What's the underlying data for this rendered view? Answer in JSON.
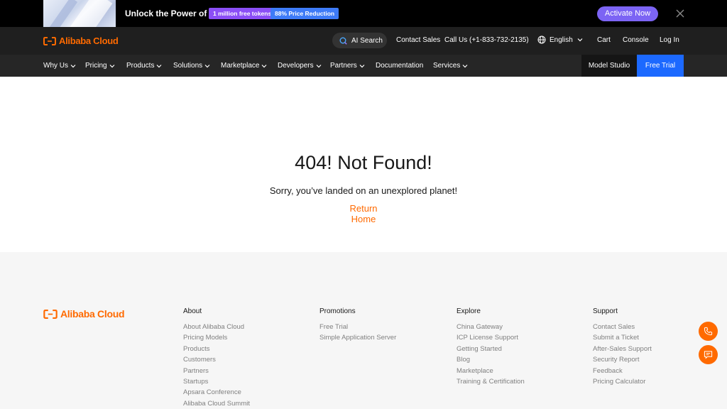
{
  "promo": {
    "title": "Unlock the Power of AI",
    "badge_tokens": "1 million free tokens",
    "badge_price": "88% Price Reduction",
    "activate_label": "Activate Now",
    "badge_purple_color": "#8b4ef6",
    "badge_blue_color": "#3e7bf7",
    "activate_color": "#7c64f4"
  },
  "header": {
    "logo_text": "Alibaba Cloud",
    "ai_search_label": "AI Search",
    "contact_sales": "Contact Sales",
    "call_us": "Call Us (+1-833-732-2135)",
    "language": "English",
    "cart": "Cart",
    "console": "Console",
    "login": "Log In",
    "brand_color": "#ff6a00"
  },
  "nav": {
    "items": [
      {
        "label": "Why Us"
      },
      {
        "label": "Pricing"
      },
      {
        "label": "Products"
      },
      {
        "label": "Solutions"
      },
      {
        "label": "Marketplace"
      },
      {
        "label": "Developers"
      },
      {
        "label": "Partners"
      },
      {
        "label": "Documentation"
      },
      {
        "label": "Services"
      }
    ],
    "model_studio": "Model Studio",
    "free_trial": "Free Trial",
    "free_trial_color": "#1c69ff"
  },
  "main": {
    "title": "404! Not Found!",
    "subtitle": "Sorry, you’ve landed on an unexplored planet!",
    "return_home": "Return Home"
  },
  "footer": {
    "logo_text": "Alibaba Cloud",
    "columns": [
      {
        "heading": "About",
        "links": [
          "About Alibaba Cloud",
          "Pricing Models",
          "Products",
          "Customers",
          "Partners",
          "Startups",
          "Apsara Conference",
          "Alibaba Cloud Summit"
        ]
      },
      {
        "heading": "Promotions",
        "links": [
          "Free Trial",
          "Simple Application Server"
        ]
      },
      {
        "heading": "Explore",
        "links": [
          "China Gateway",
          "ICP License Support",
          "Getting Started",
          "Blog",
          "Marketplace",
          "Training & Certification"
        ]
      },
      {
        "heading": "Support",
        "links": [
          "Contact Sales",
          "Submit a Ticket",
          "After-Sales Support",
          "Security Report",
          "Feedback",
          "Pricing Calculator"
        ]
      }
    ]
  },
  "floating": {
    "phone_icon": "phone-icon",
    "chat_icon": "chat-icon"
  }
}
